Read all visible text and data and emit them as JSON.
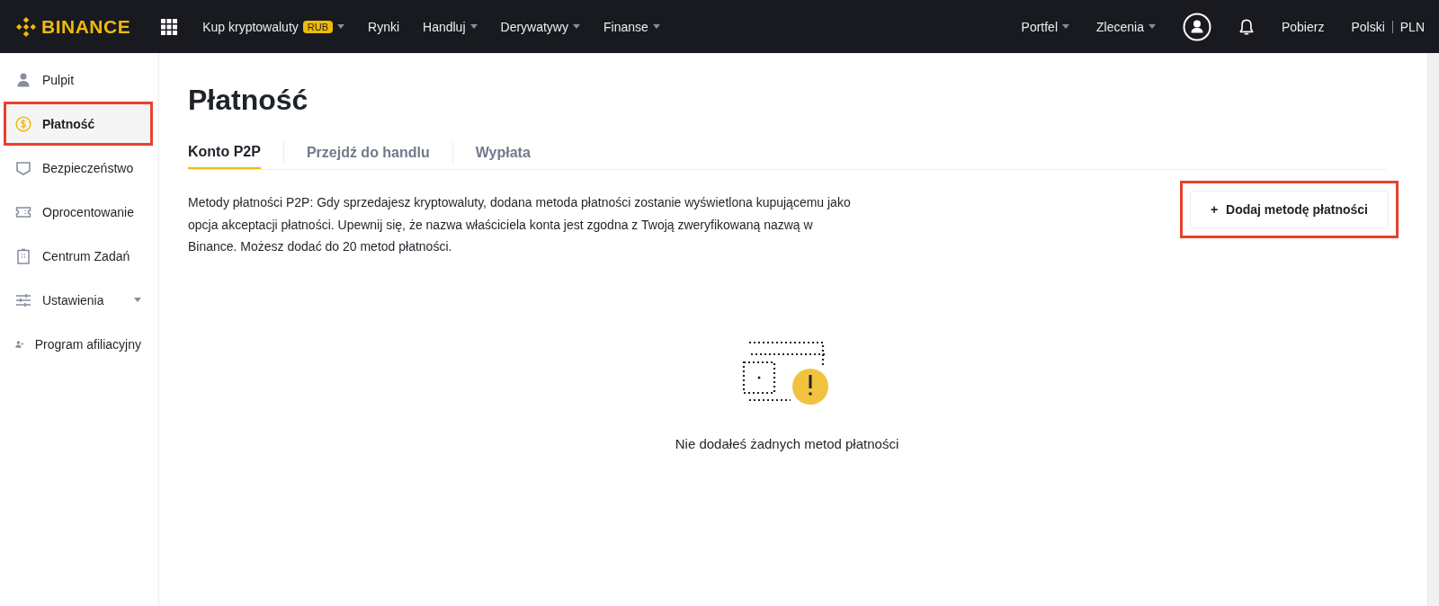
{
  "header": {
    "logo": "BINANCE",
    "nav": [
      {
        "label": "Kup kryptowaluty",
        "badge": "RUB",
        "dropdown": true
      },
      {
        "label": "Rynki",
        "dropdown": false
      },
      {
        "label": "Handluj",
        "dropdown": true
      },
      {
        "label": "Derywatywy",
        "dropdown": true
      },
      {
        "label": "Finanse",
        "dropdown": true
      }
    ],
    "right": [
      {
        "label": "Portfel",
        "dropdown": true
      },
      {
        "label": "Zlecenia",
        "dropdown": true
      }
    ],
    "download": "Pobierz",
    "language": "Polski",
    "currency": "PLN"
  },
  "sidebar": {
    "items": [
      {
        "label": "Pulpit",
        "kind": "person",
        "selected": false,
        "highlighted": false,
        "expandable": false
      },
      {
        "label": "Płatność",
        "kind": "coin",
        "selected": true,
        "highlighted": true,
        "expandable": false
      },
      {
        "label": "Bezpieczeństwo",
        "kind": "shield",
        "selected": false,
        "highlighted": false,
        "expandable": false
      },
      {
        "label": "Oprocentowanie",
        "kind": "ticket",
        "selected": false,
        "highlighted": false,
        "expandable": false
      },
      {
        "label": "Centrum Zadań",
        "kind": "clipboard",
        "selected": false,
        "highlighted": false,
        "expandable": false
      },
      {
        "label": "Ustawienia",
        "kind": "sliders",
        "selected": false,
        "highlighted": false,
        "expandable": true
      },
      {
        "label": "Program afiliacyjny",
        "kind": "person-add",
        "selected": false,
        "highlighted": false,
        "expandable": false
      }
    ]
  },
  "page": {
    "title": "Płatność",
    "tabs": [
      {
        "label": "Konto P2P",
        "selected": true
      },
      {
        "label": "Przejdź do handlu",
        "selected": false
      },
      {
        "label": "Wypłata",
        "selected": false
      }
    ],
    "description": "Metody płatności P2P: Gdy sprzedajesz kryptowaluty, dodana metoda płatności zostanie wyświetlona kupującemu jako opcja akceptacji płatności. Upewnij się, że nazwa właściciela konta jest zgodna z Twoją zweryfikowaną nazwą w Binance. Możesz dodać do 20 metod płatności.",
    "add_button": {
      "icon": "+",
      "label": "Dodaj metodę płatności",
      "highlighted": true
    },
    "empty_state": "Nie dodałeś żadnych metod płatności"
  }
}
